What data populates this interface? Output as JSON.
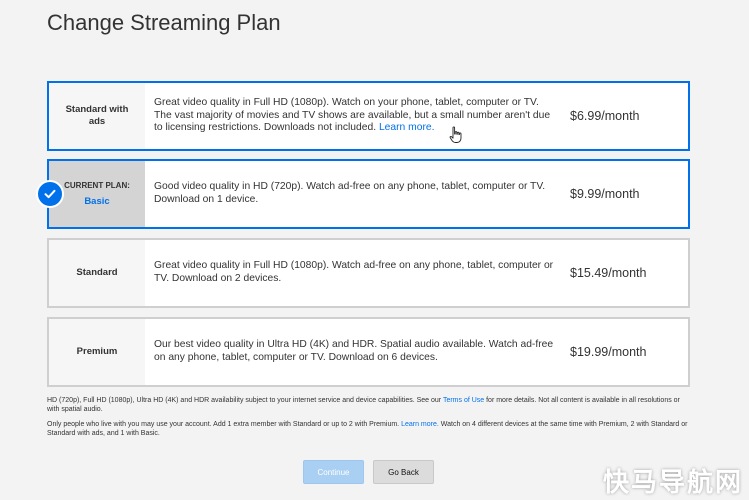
{
  "page": {
    "title": "Change Streaming Plan"
  },
  "plans": [
    {
      "name": "Standard with ads",
      "description": "Great video quality in Full HD (1080p). Watch on your phone, tablet, computer or TV. The vast majority of movies and TV shows are available, but a small number aren't due to licensing restrictions. Downloads not included.",
      "link": "Learn more.",
      "price": "$6.99/month"
    },
    {
      "current_label": "CURRENT PLAN:",
      "name": "Basic",
      "description": "Good video quality in HD (720p). Watch ad-free on any phone, tablet, computer or TV. Download on 1 device.",
      "price": "$9.99/month"
    },
    {
      "name": "Standard",
      "description": "Great video quality in Full HD (1080p). Watch ad-free on any phone, tablet, computer or TV. Download on 2 devices.",
      "price": "$15.49/month"
    },
    {
      "name": "Premium",
      "description": "Our best video quality in Ultra HD (4K) and HDR. Spatial audio available. Watch ad-free on any phone, tablet, computer or TV. Download on 6 devices.",
      "price": "$19.99/month"
    }
  ],
  "notes": {
    "note1_pre": "HD (720p), Full HD (1080p), Ultra HD (4K) and HDR availability subject to your internet service and device capabilities. See our ",
    "note1_link": "Terms of Use",
    "note1_post": " for more details. Not all content is available in all resolutions or with spatial audio.",
    "note2_pre": "Only people who live with you may use your account. Add 1 extra member with Standard or up to 2 with Premium. ",
    "note2_link": "Learn more.",
    "note2_post": " Watch on 4 different devices at the same time with Premium, 2 with Standard or Standard with ads, and 1 with Basic."
  },
  "buttons": {
    "continue": "Continue",
    "back": "Go Back"
  },
  "watermark": "快马导航网",
  "colors": {
    "accent": "#0071eb",
    "continue_disabled": "#a9cff2"
  }
}
